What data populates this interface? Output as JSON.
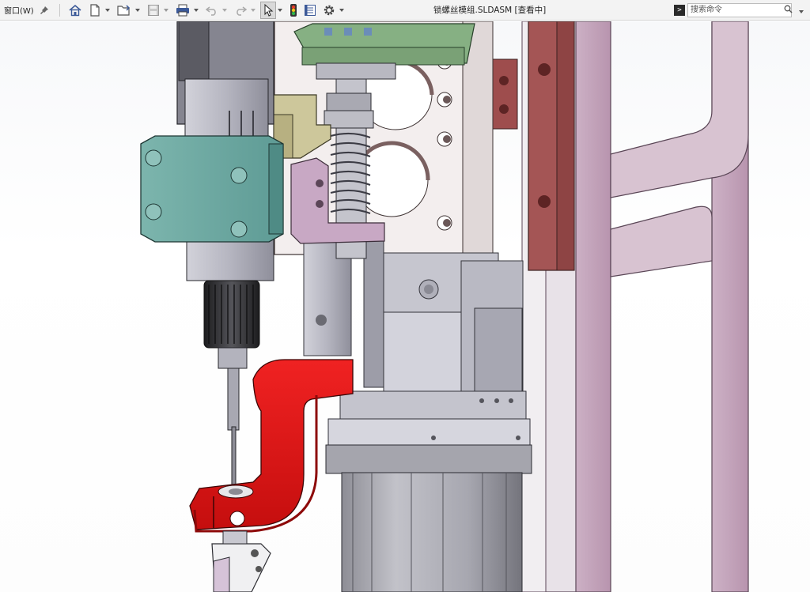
{
  "toolbar": {
    "window_menu": "窗口(W)",
    "document_title": "锁螺丝模组.SLDASM [查看中]",
    "icons": [
      "pin-icon",
      "home-icon",
      "new-document-icon",
      "open-icon",
      "save-icon",
      "print-icon",
      "undo-icon",
      "redo-icon",
      "select-arrow-icon",
      "rebuild-traffic-light-icon",
      "file-properties-icon",
      "options-gear-icon"
    ]
  },
  "search": {
    "placeholder": "搜索命令",
    "cmd_icon": ">"
  },
  "colors": {
    "red_bracket": "#e8191b",
    "teal_block": "#6fa9a3",
    "lilac_frame": "#c8a9c0",
    "maroon_bar": "#a25252",
    "cream_plate": "#f2ecec",
    "gray_steel": "#b7b7c1",
    "green_cap": "#86b083",
    "khaki": "#cdc79b"
  }
}
